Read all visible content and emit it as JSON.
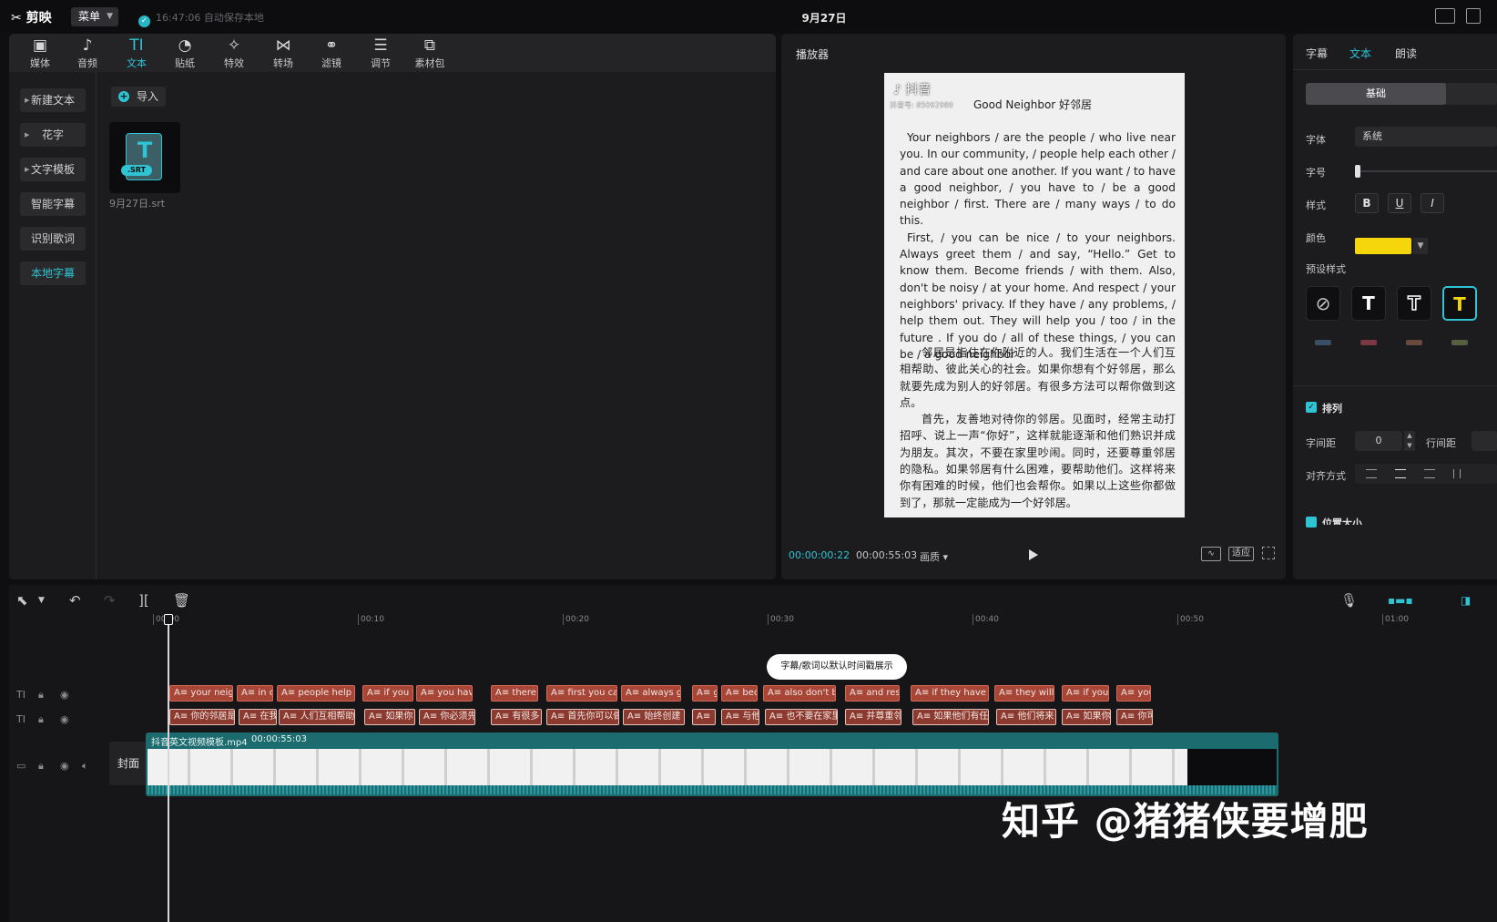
{
  "titlebar": {
    "app_name": "剪映",
    "menu_label": "菜单",
    "autosave": "16:47:06 自动保存本地",
    "project_title": "9月27日"
  },
  "toolbar": {
    "tools": [
      {
        "label": "媒体",
        "icon": "media-icon"
      },
      {
        "label": "音频",
        "icon": "audio-icon"
      },
      {
        "label": "文本",
        "icon": "text-icon",
        "active": true
      },
      {
        "label": "贴纸",
        "icon": "sticker-icon"
      },
      {
        "label": "特效",
        "icon": "effects-icon"
      },
      {
        "label": "转场",
        "icon": "transition-icon"
      },
      {
        "label": "滤镜",
        "icon": "filter-icon"
      },
      {
        "label": "调节",
        "icon": "adjust-icon"
      },
      {
        "label": "素材包",
        "icon": "package-icon"
      }
    ]
  },
  "leftnav": {
    "items": [
      "新建文本",
      "花字",
      "文字模板",
      "智能字幕",
      "识别歌词",
      "本地字幕"
    ],
    "active": "本地字幕"
  },
  "library": {
    "import_label": "导入",
    "file_badge": ".SRT",
    "file_name": "9月27日.srt"
  },
  "player": {
    "title": "播放器",
    "video": {
      "platform": "抖音",
      "account_id": "抖音号: 85092989",
      "heading": "Good Neighbor  好邻居",
      "en_paragraphs": [
        "Your neighbors / are the people / who live near you. In our community, / people help each other / and care about one another. If you want / to have a good neighbor, / you have to / be a good neighbor / first. There are / many ways / to do this.",
        "First, / you can be nice / to your neighbors. Always greet them / and say, “Hello.” Get to know them. Become friends / with them. Also, don't be noisy / at your home. And respect / your neighbors' privacy. If they have / any problems, / help them out. They will help you / too / in the future . If you do / all of these things, / you can be / a good neighbor ."
      ],
      "cn_paragraphs": [
        "邻居是指住在你附近的人。我们生活在一个人们互相帮助、彼此关心的社会。如果你想有个好邻居，那么就要先成为别人的好邻居。有很多方法可以帮你做到这点。",
        "首先，友善地对待你的邻居。见面时，经常主动打招呼、说上一声“你好”，这样就能逐渐和他们熟识并成为朋友。其次，不要在家里吵闹。同时，还要尊重邻居的隐私。如果邻居有什么困难，要帮助他们。这样将来你有困难的时候，他们也会帮你。如果以上这些你都做到了，那就一定能成为一个好邻居。"
      ]
    },
    "time_current": "00:00:00:22",
    "time_total": "00:00:55:03",
    "quality_label": "画质",
    "fit_label": "适应"
  },
  "properties": {
    "tabs": [
      "字幕",
      "文本",
      "朗读"
    ],
    "active_tab": "文本",
    "segment": "基础",
    "font_label": "字体",
    "font_value": "系统",
    "size_label": "字号",
    "style_label": "样式",
    "bold": "B",
    "underline": "U",
    "italic": "I",
    "color_label": "颜色",
    "color_value": "#f5d60c",
    "preset_label": "预设样式",
    "arrange_label": "排列",
    "letter_spacing_label": "字间距",
    "letter_spacing_value": "0",
    "line_spacing_label": "行间距",
    "align_label": "对齐方式",
    "position_label": "位置大小"
  },
  "timeline": {
    "ruler": [
      "00:00",
      "00:10",
      "00:20",
      "00:30",
      "00:40",
      "00:50",
      "01:00"
    ],
    "tooltip": "字幕/歌词以默认时间戳展示",
    "en_clips": [
      "your neigh",
      "in c",
      "people help e",
      "if you v",
      "you have",
      "there",
      "first you car",
      "always g",
      "g",
      "bec",
      "also don't b",
      "and res",
      "if they have a",
      "they will",
      "if you c",
      "you"
    ],
    "cn_clips": [
      "你的邻居是",
      "在我",
      "人们互相帮助",
      "如果你",
      "你必须先",
      "有很多",
      "首先你可以做",
      "始终创建",
      "",
      "与他",
      "也不要在家里",
      "并尊重邻",
      "如果他们有任何",
      "他们将来",
      "如果你",
      "你可"
    ],
    "video_name": "抖音英文视频模板.mp4",
    "video_duration": "00:00:55:03",
    "cover_label": "封面"
  },
  "watermark": "知乎 @猪猪侠要增肥",
  "colors": {
    "accent": "#2ec4d4",
    "subtitle_clip": "#a74537",
    "video_track": "#1c6c6f"
  }
}
